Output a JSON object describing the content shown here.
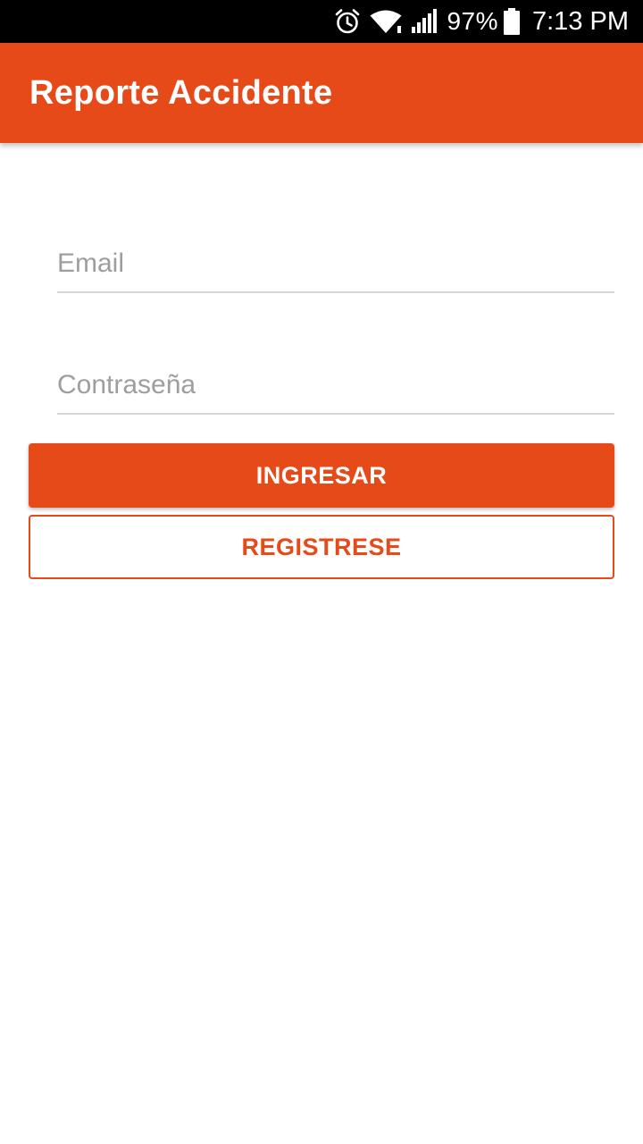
{
  "status_bar": {
    "icons": [
      "alarm-icon",
      "wifi-icon",
      "signal-icon",
      "battery-icon"
    ],
    "battery_percent": "97%",
    "time": "7:13 PM"
  },
  "app_bar": {
    "title": "Reporte Accidente",
    "color": "#e64a19"
  },
  "login_form": {
    "email_placeholder": "Email",
    "password_placeholder": "Contraseña",
    "login_label": "INGRESAR",
    "register_label": "REGISTRESE"
  },
  "colors": {
    "accent": "#e64a19",
    "status_bar": "#000000",
    "placeholder": "#9e9e9e",
    "divider": "#d6d6d6"
  }
}
